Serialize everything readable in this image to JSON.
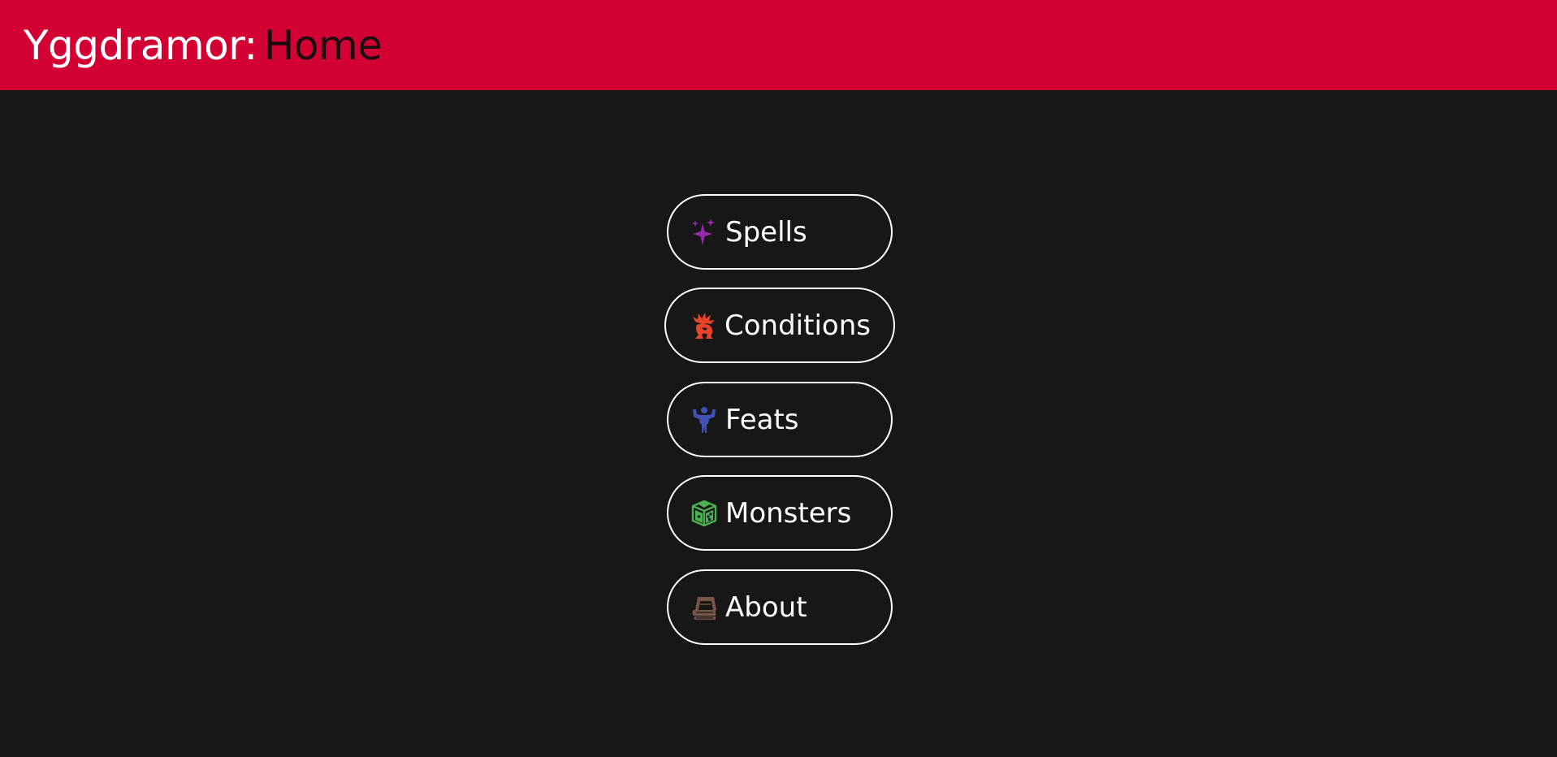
{
  "header": {
    "brand": "Yggdramor:",
    "page": "Home",
    "background_color": "#d30033"
  },
  "nav": {
    "items": [
      {
        "label": "Spells",
        "icon": "sparkles-icon",
        "icon_color": "#9b27b0"
      },
      {
        "label": "Conditions",
        "icon": "burning-creature-icon",
        "icon_color": "#e8442c"
      },
      {
        "label": "Feats",
        "icon": "strongman-icon",
        "icon_color": "#3f51b5"
      },
      {
        "label": "Monsters",
        "icon": "dice-cube-icon",
        "icon_color": "#4caf50"
      },
      {
        "label": "About",
        "icon": "book-icon",
        "icon_color": "#795548"
      }
    ]
  }
}
